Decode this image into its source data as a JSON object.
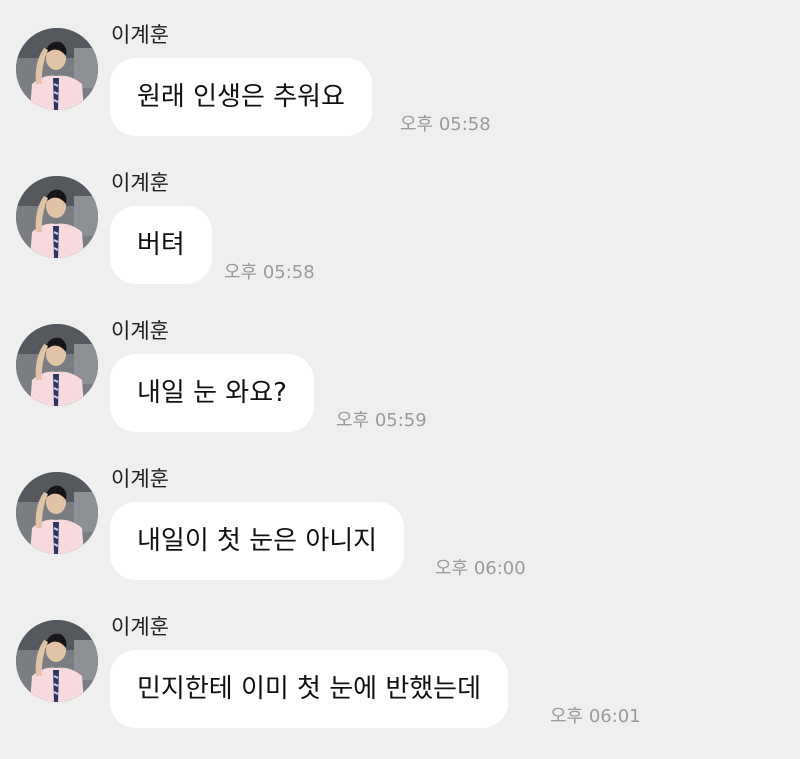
{
  "chat": {
    "messages": [
      {
        "sender": "이계훈",
        "text": "원래 인생은 추워요",
        "time": "오후 05:58"
      },
      {
        "sender": "이계훈",
        "text": "버텨",
        "time": "오후 05:58"
      },
      {
        "sender": "이계훈",
        "text": "내일 눈 와요?",
        "time": "오후 05:59"
      },
      {
        "sender": "이계훈",
        "text": "내일이 첫 눈은 아니지",
        "time": "오후 06:00"
      },
      {
        "sender": "이계훈",
        "text": "민지한테 이미 첫 눈에 반했는데",
        "time": "오후 06:01"
      }
    ]
  },
  "colors": {
    "background": "#efefef",
    "bubble": "#ffffff",
    "timestamp": "#9a9a9a"
  },
  "icons": {
    "avatar": "profile-photo-avatar"
  }
}
